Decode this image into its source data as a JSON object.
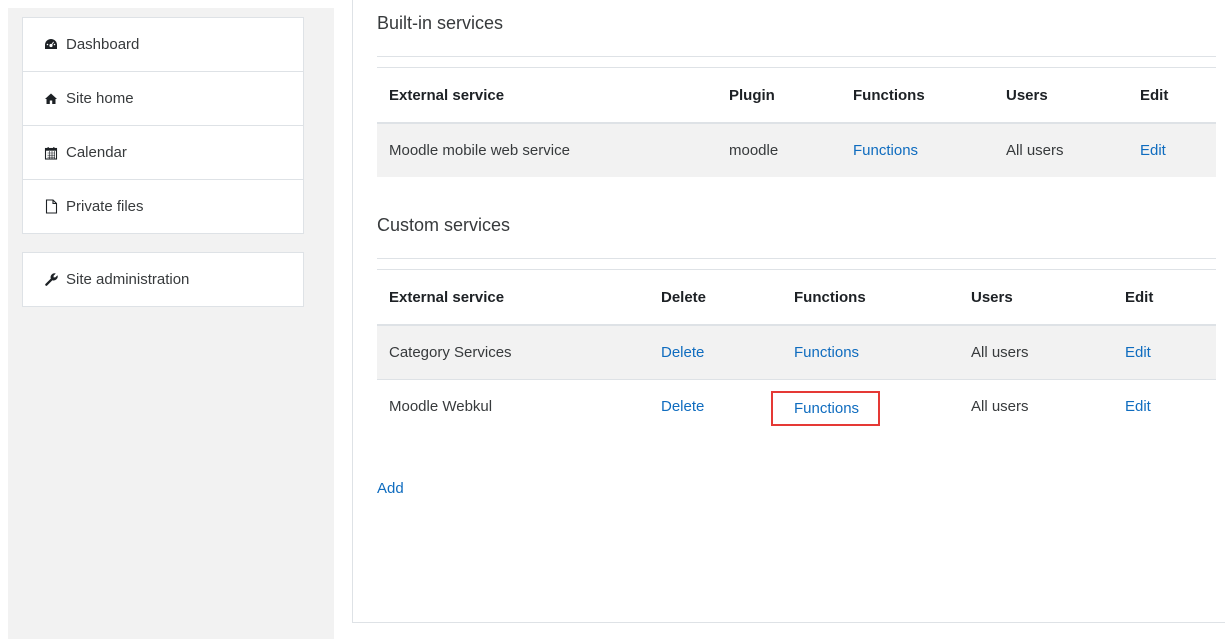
{
  "nav": {
    "primary": [
      {
        "label": "Dashboard",
        "icon": "dashboard-icon"
      },
      {
        "label": "Site home",
        "icon": "home-icon"
      },
      {
        "label": "Calendar",
        "icon": "calendar-icon"
      },
      {
        "label": "Private files",
        "icon": "file-icon"
      }
    ],
    "admin": [
      {
        "label": "Site administration",
        "icon": "wrench-icon"
      }
    ]
  },
  "builtin": {
    "title": "Built-in services",
    "headers": [
      "External service",
      "Plugin",
      "Functions",
      "Users",
      "Edit"
    ],
    "rows": [
      {
        "service": "Moodle mobile web service",
        "plugin": "moodle",
        "functions": "Functions",
        "users": "All users",
        "edit": "Edit"
      }
    ]
  },
  "custom": {
    "title": "Custom services",
    "headers": [
      "External service",
      "Delete",
      "Functions",
      "Users",
      "Edit"
    ],
    "rows": [
      {
        "service": "Category Services",
        "delete": "Delete",
        "functions": "Functions",
        "users": "All users",
        "edit": "Edit"
      },
      {
        "service": "Moodle Webkul",
        "delete": "Delete",
        "functions": "Functions",
        "users": "All users",
        "edit": "Edit",
        "highlighted": true
      }
    ]
  },
  "add_label": "Add",
  "colors": {
    "link": "#0f6cbf",
    "highlight_border": "#e53935",
    "drawer_bg": "#f2f2f2",
    "row_stripe": "#f2f2f2"
  }
}
